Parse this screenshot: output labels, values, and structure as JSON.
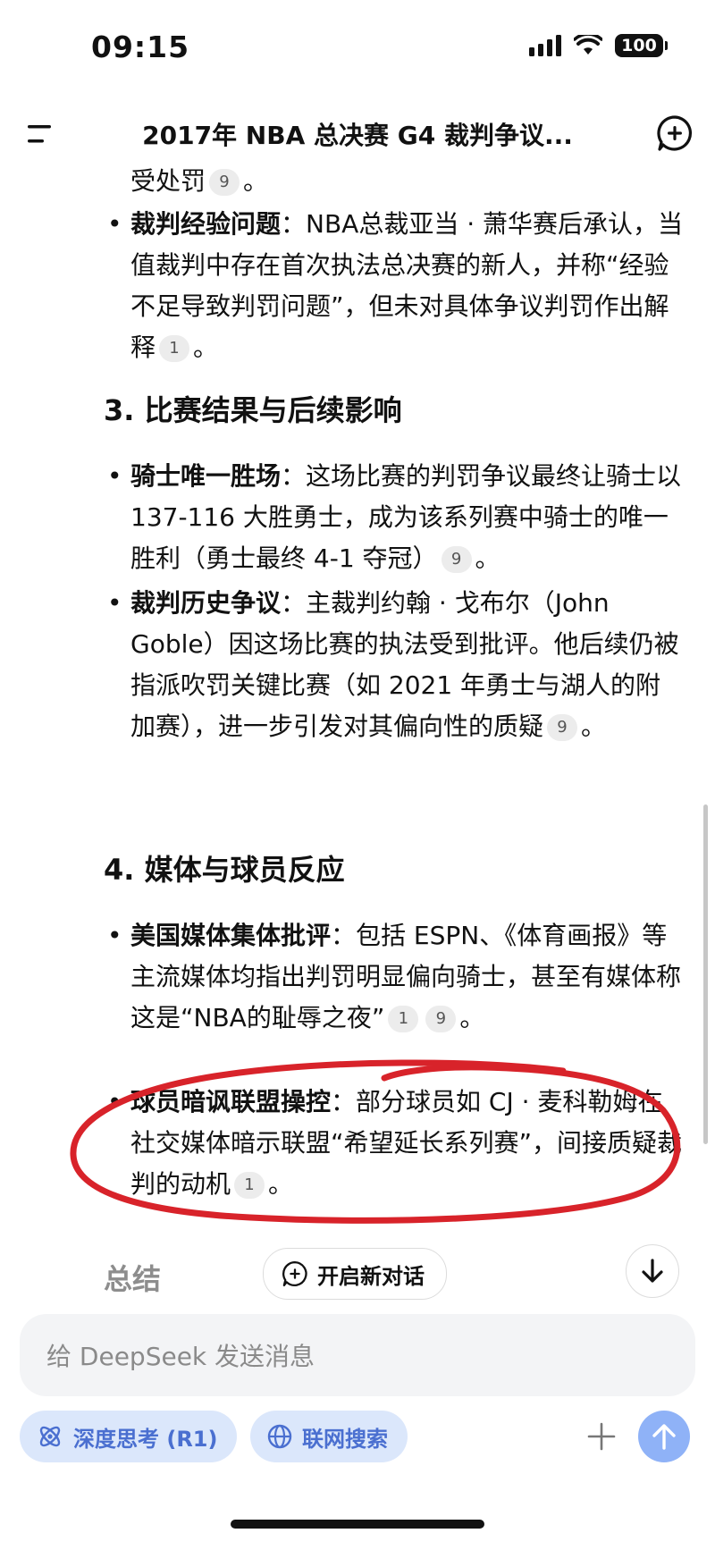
{
  "status_bar": {
    "time": "09:15",
    "battery": "100"
  },
  "header": {
    "title": "2017年 NBA 总决赛 G4 裁判争议..."
  },
  "content": {
    "line_top": "受处罚",
    "b1_title": "裁判经验问题",
    "b1_text": "：NBA总裁亚当 · 萧华赛后承认，当值裁判中存在首次执法总决赛的新人，并称“经验不足导致判罚问题”，但未对具体争议判罚作出解释",
    "s3_title": "3. 比赛结果与后续影响",
    "b2_title": "骑士唯一胜场",
    "b2_text": "：这场比赛的判罚争议最终让骑士以 137-116 大胜勇士，成为该系列赛中骑士的唯一胜利（勇士最终 4-1 夺冠）",
    "b3_title": "裁判历史争议",
    "b3_text": "：主裁判约翰 · 戈布尔（John Goble）因这场比赛的执法受到批评。他后续仍被指派吹罚关键比赛（如 2021 年勇士与湖人的附加赛），进一步引发对其偏向性的质疑",
    "s4_title": "4. 媒体与球员反应",
    "b4_title": "美国媒体集体批评",
    "b4_text": "：包括 ESPN、《体育画报》等主流媒体均指出判罚明显偏向骑士，甚至有媒体称这是“NBA的耻辱之夜”",
    "b5_title": "球员暗讽联盟操控",
    "b5_text": "：部分球员如 CJ · 麦科勒姆在社交媒体暗示联盟“希望延长系列赛”，间接质疑裁判的动机",
    "period": "。",
    "cite_1": "1",
    "cite_9": "9"
  },
  "bottom": {
    "summary_label": "总结",
    "new_chat_label": "开启新对话"
  },
  "input": {
    "placeholder": "给 DeepSeek 发送消息"
  },
  "controls": {
    "deep_think_label": "深度思考 (R1)",
    "web_search_label": "联网搜索"
  },
  "colors": {
    "accent": "#4a6fd0",
    "pill_bg": "#dbe7fb",
    "send_bg": "#8fb2f7",
    "annotation": "#d8232a"
  },
  "icons": {
    "menu": "menu-icon",
    "new_chat": "new-chat-icon",
    "scroll_down": "arrow-down-icon",
    "deep_think": "atom-icon",
    "web_search": "globe-icon",
    "plus": "plus-icon",
    "send": "arrow-up-icon"
  }
}
